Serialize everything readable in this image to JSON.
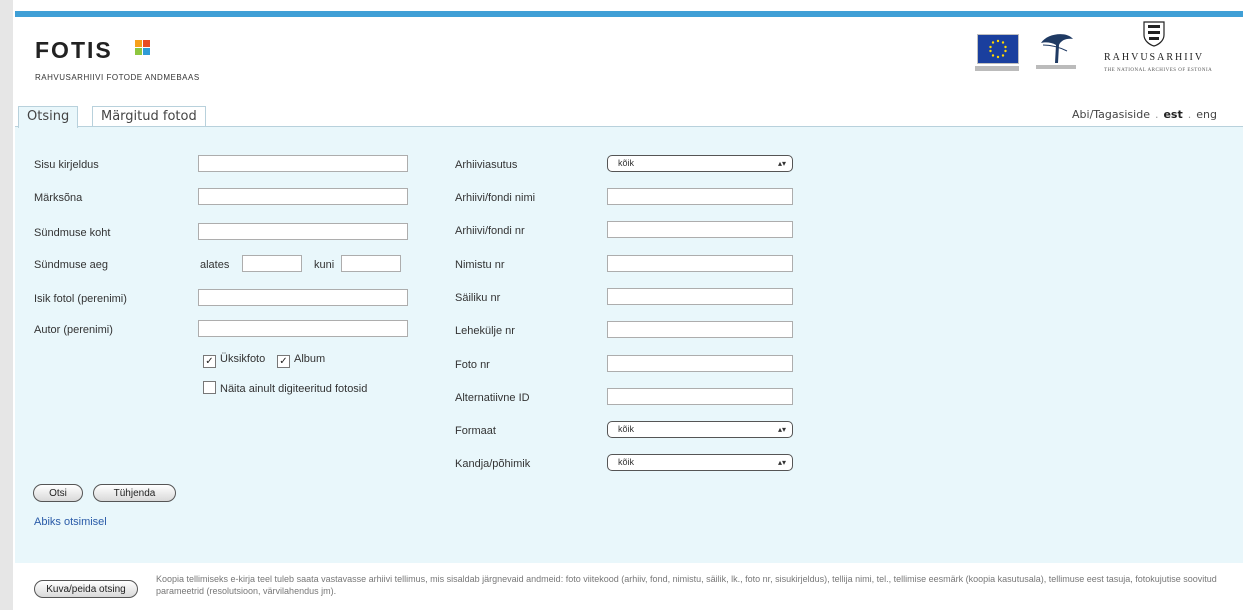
{
  "header": {
    "logo_text": "FOTIS",
    "logo_subtitle": "RAHVUSARHIIVI FOTODE ANDMEBAAS",
    "archive_name": "RAHVUSARHIIV",
    "archive_subtitle": "THE NATIONAL ARCHIVES OF ESTONIA",
    "logo_mark_colors": [
      "#f6a01a",
      "#e84b24",
      "#8dc63f",
      "#2f9bd6"
    ]
  },
  "tabs": [
    {
      "label": "Otsing",
      "active": true
    },
    {
      "label": "Märgitud fotod",
      "active": false
    }
  ],
  "top_links": {
    "feedback": "Abi/Tagasiside",
    "lang_est": "est",
    "lang_eng": "eng"
  },
  "form_left": {
    "content_desc": "Sisu kirjeldus",
    "keyword": "Märksõna",
    "event_place": "Sündmuse koht",
    "event_time": "Sündmuse aeg",
    "from": "alates",
    "to": "kuni",
    "person": "Isik fotol (perenimi)",
    "author": "Autor (perenimi)",
    "single_photo": "Üksikfoto",
    "album": "Album",
    "digitized_only": "Näita ainult digiteeritud fotosid"
  },
  "form_right": {
    "archive_institution": "Arhiiviasutus",
    "archive_name": "Arhiivi/fondi nimi",
    "archive_no": "Arhiivi/fondi nr",
    "list_no": "Nimistu nr",
    "item_no": "Säiliku nr",
    "page_no": "Lehekülje nr",
    "photo_no": "Foto nr",
    "alt_id": "Alternatiivne ID",
    "format": "Formaat",
    "carrier": "Kandja/põhimik",
    "select_all": "kõik"
  },
  "buttons": {
    "search": "Otsi",
    "clear": "Tühjenda",
    "toggle_search": "Kuva/peida otsing"
  },
  "help_link": "Abiks otsimisel",
  "notice": "Koopia tellimiseks e-kirja teel tuleb saata vastavasse arhiivi tellimus, mis sisaldab järgnevaid andmeid: foto viitekood (arhiiv, fond, nimistu, säilik, lk., foto nr, sisukirjeldus), tellija nimi, tel., tellimise eesmärk (koopia kasutusala), tellimuse eest tasuja, fotokujutise soovitud parameetrid (resolutsioon, värvilahendus jm).",
  "colors": {
    "top_bar": "#3f9fd6",
    "panel_bg": "#e9f7fb",
    "link": "#2a5ba8"
  }
}
